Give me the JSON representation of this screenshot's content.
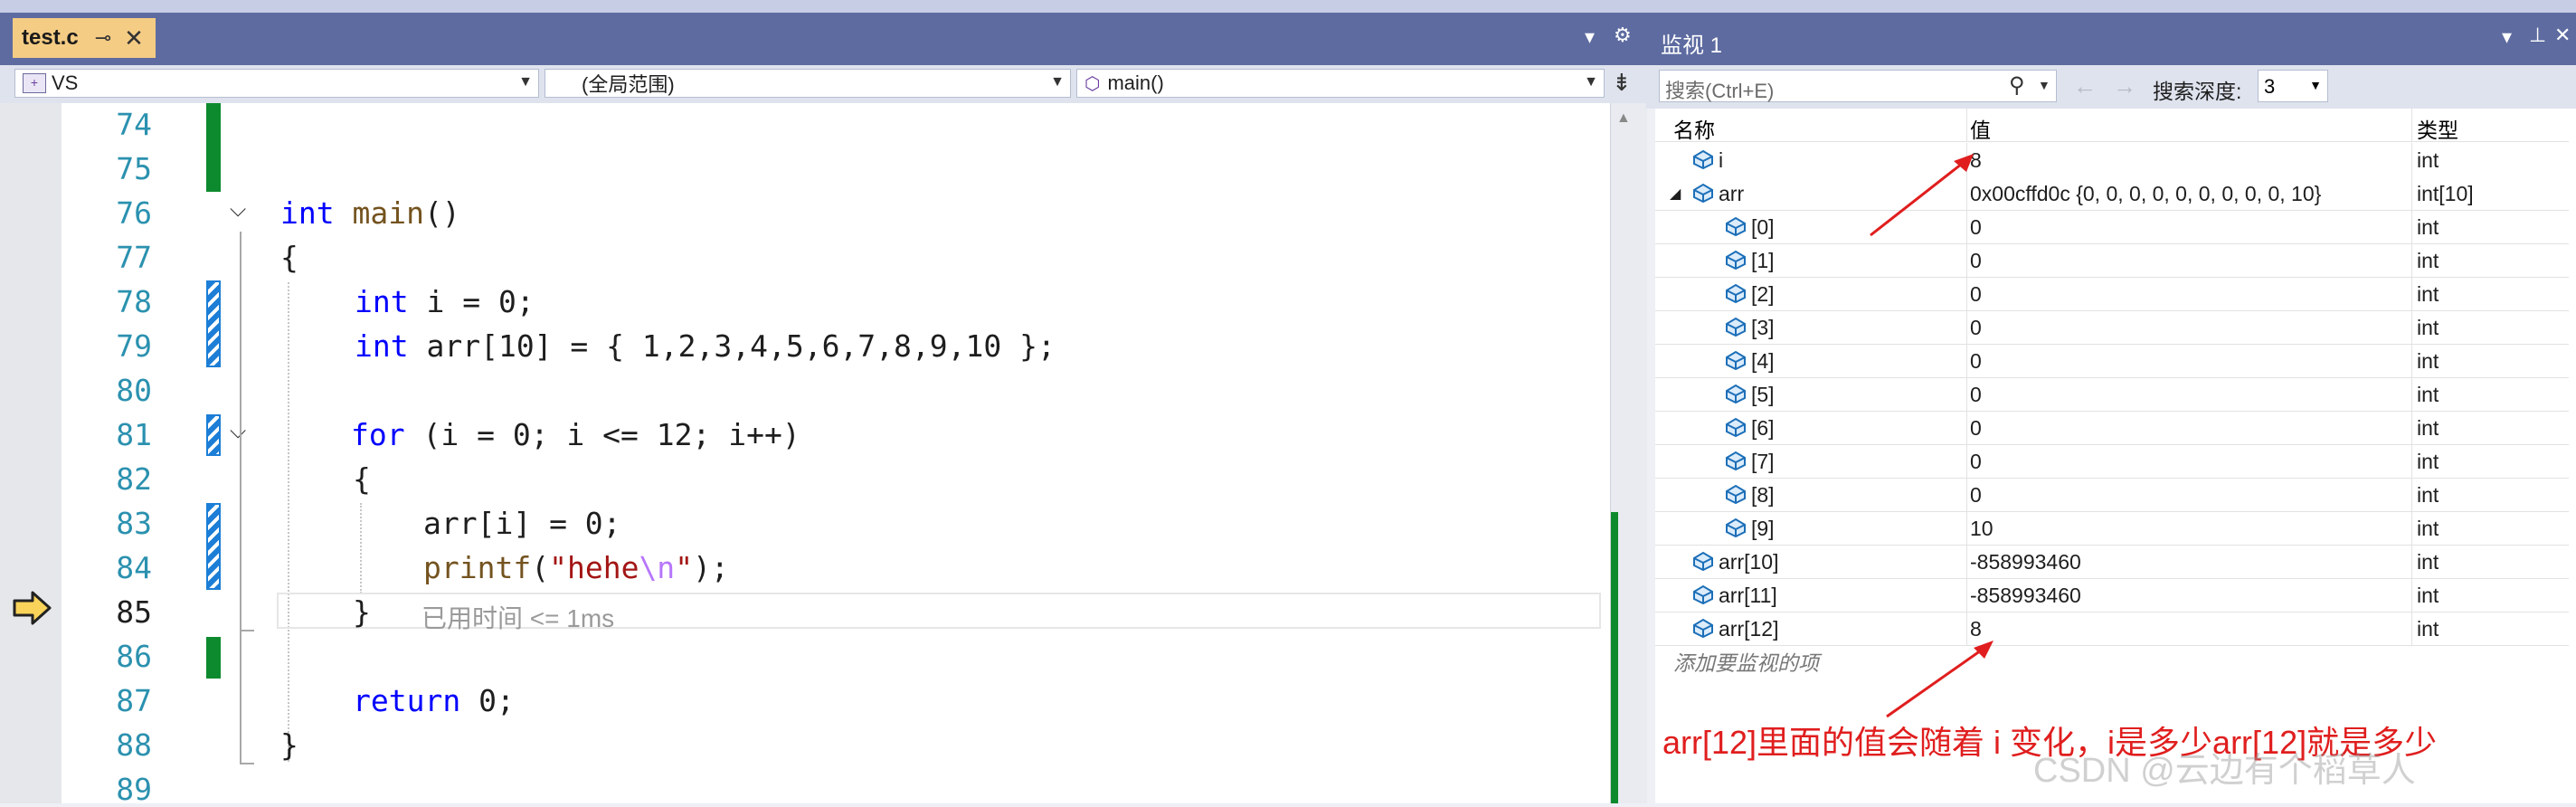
{
  "editor": {
    "tab": {
      "name": "test.c",
      "pin": "⊸",
      "close": "✕"
    },
    "nav": {
      "project": "VS",
      "scope": "(全局范围)",
      "function": "main()"
    },
    "line_numbers": [
      "74",
      "75",
      "76",
      "77",
      "78",
      "79",
      "80",
      "81",
      "82",
      "83",
      "84",
      "85",
      "86",
      "87",
      "88",
      "89"
    ],
    "lines": {
      "l76_kw": "int",
      "l76_fn": "main",
      "l76_rest": "()",
      "l77": "{",
      "l78_kw": "int",
      "l78_rest": " i = 0;",
      "l79_kw": "int",
      "l79_rest": " arr[10] = { 1,2,3,4,5,6,7,8,9,10 };",
      "l81_kw": "for",
      "l81_rest": " (i = 0; i <= 12; i++)",
      "l82": "{",
      "l83": "arr[i] = 0;",
      "l84_fn": "printf",
      "l84_p1": "(",
      "l84_s1": "\"hehe",
      "l84_esc": "\\n",
      "l84_s2": "\"",
      "l84_p2": ");",
      "l85": "}",
      "l85_perf": "已用时间 <= 1ms",
      "l87_kw": "return",
      "l87_rest": " 0;",
      "l88": "}"
    }
  },
  "watch": {
    "title": "监视 1",
    "search_placeholder": "搜索(Ctrl+E)",
    "depth_label": "搜索深度:",
    "depth_value": "3",
    "columns": {
      "name": "名称",
      "value": "值",
      "type": "类型"
    },
    "rows": [
      {
        "name": "i",
        "value": "8",
        "type": "int"
      },
      {
        "name": "arr",
        "value": "0x00cffd0c {0, 0, 0, 0, 0, 0, 0, 0, 0, 10}",
        "type": "int[10]"
      },
      {
        "name": "[0]",
        "value": "0",
        "type": "int"
      },
      {
        "name": "[1]",
        "value": "0",
        "type": "int"
      },
      {
        "name": "[2]",
        "value": "0",
        "type": "int"
      },
      {
        "name": "[3]",
        "value": "0",
        "type": "int"
      },
      {
        "name": "[4]",
        "value": "0",
        "type": "int"
      },
      {
        "name": "[5]",
        "value": "0",
        "type": "int"
      },
      {
        "name": "[6]",
        "value": "0",
        "type": "int"
      },
      {
        "name": "[7]",
        "value": "0",
        "type": "int"
      },
      {
        "name": "[8]",
        "value": "0",
        "type": "int"
      },
      {
        "name": "[9]",
        "value": "10",
        "type": "int"
      },
      {
        "name": "arr[10]",
        "value": "-858993460",
        "type": "int"
      },
      {
        "name": "arr[11]",
        "value": "-858993460",
        "type": "int"
      },
      {
        "name": "arr[12]",
        "value": "8",
        "type": "int"
      }
    ],
    "add_item": "添加要监视的项"
  },
  "annotation": "arr[12]里面的值会随着 i 变化，i是多少arr[12]就是多少",
  "watermark": "CSDN @云边有个稻草人",
  "colors": {
    "accent_tab": "#f5cc84",
    "title_bar": "#5d6ba0",
    "annotation": "#e01e1e",
    "change_green": "#0e8a2e",
    "change_blue": "#1c7ed6"
  }
}
